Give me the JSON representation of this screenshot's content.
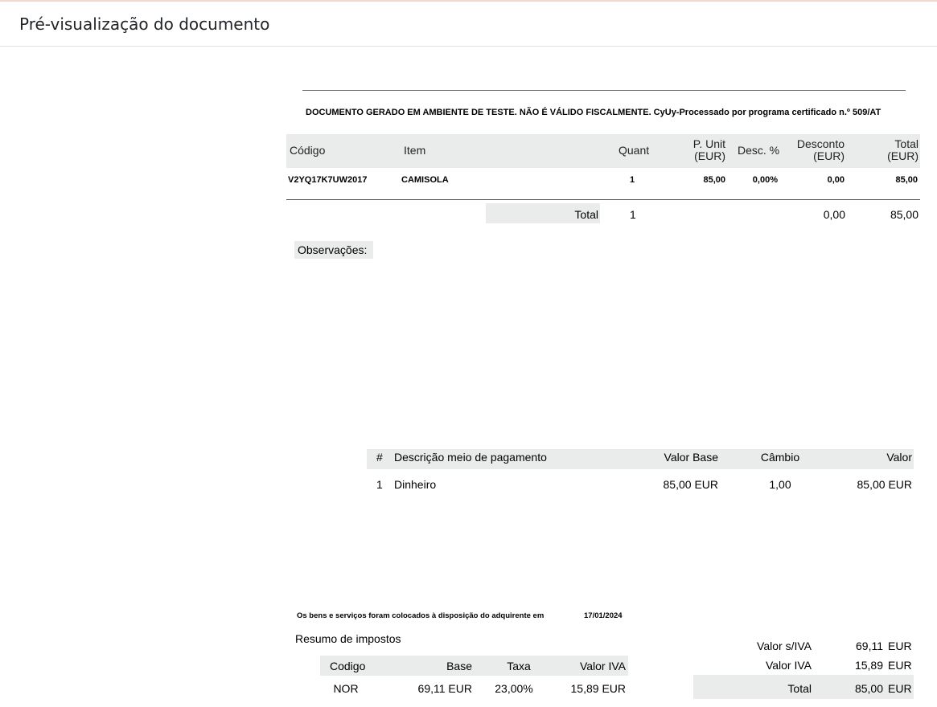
{
  "modal": {
    "title": "Pré-visualização do documento"
  },
  "notice": "DOCUMENTO GERADO EM AMBIENTE DE TESTE. NÃO É VÁLIDO FISCALMENTE. CyUy-Processado por programa certificado n.º 509/AT",
  "items_table": {
    "headers": {
      "code": "Código",
      "item": "Item",
      "qty": "Quant",
      "unit_price_1": "P. Unit",
      "unit_price_2": "(EUR)",
      "disc_pct": "Desc. %",
      "discount_1": "Desconto",
      "discount_2": "(EUR)",
      "total_1": "Total",
      "total_2": "(EUR)"
    },
    "rows": [
      {
        "code": "V2YQ17K7UW2017",
        "item": "CAMISOLA",
        "qty": "1",
        "unit_price": "85,00",
        "disc_pct": "0,00%",
        "discount": "0,00",
        "total": "85,00"
      }
    ],
    "totals": {
      "label": "Total",
      "qty": "1",
      "discount": "0,00",
      "total": "85,00"
    }
  },
  "observations_label": "Observações:",
  "payments_table": {
    "headers": {
      "num": "#",
      "desc": "Descrição meio de pagamento",
      "base": "Valor Base",
      "rate": "Câmbio",
      "value": "Valor"
    },
    "rows": [
      {
        "num": "1",
        "desc": "Dinheiro",
        "base": "85,00 EUR",
        "rate": "1,00",
        "value": "85,00 EUR"
      }
    ]
  },
  "availability": {
    "text": "Os bens e serviços foram colocados à disposição do adquirente em",
    "date": "17/01/2024"
  },
  "tax_summary": {
    "title": "Resumo de impostos",
    "headers": {
      "code": "Codigo",
      "base": "Base",
      "rate": "Taxa",
      "vat": "Valor IVA"
    },
    "rows": [
      {
        "code": "NOR",
        "base": "69,11 EUR",
        "rate": "23,00%",
        "vat": "15,89 EUR"
      }
    ]
  },
  "summary": {
    "rows": [
      {
        "label": "Valor s/IVA",
        "value": "69,11",
        "currency": "EUR"
      },
      {
        "label": "Valor IVA",
        "value": "15,89",
        "currency": "EUR"
      },
      {
        "label": "Total",
        "value": "85,00",
        "currency": "EUR"
      }
    ]
  }
}
